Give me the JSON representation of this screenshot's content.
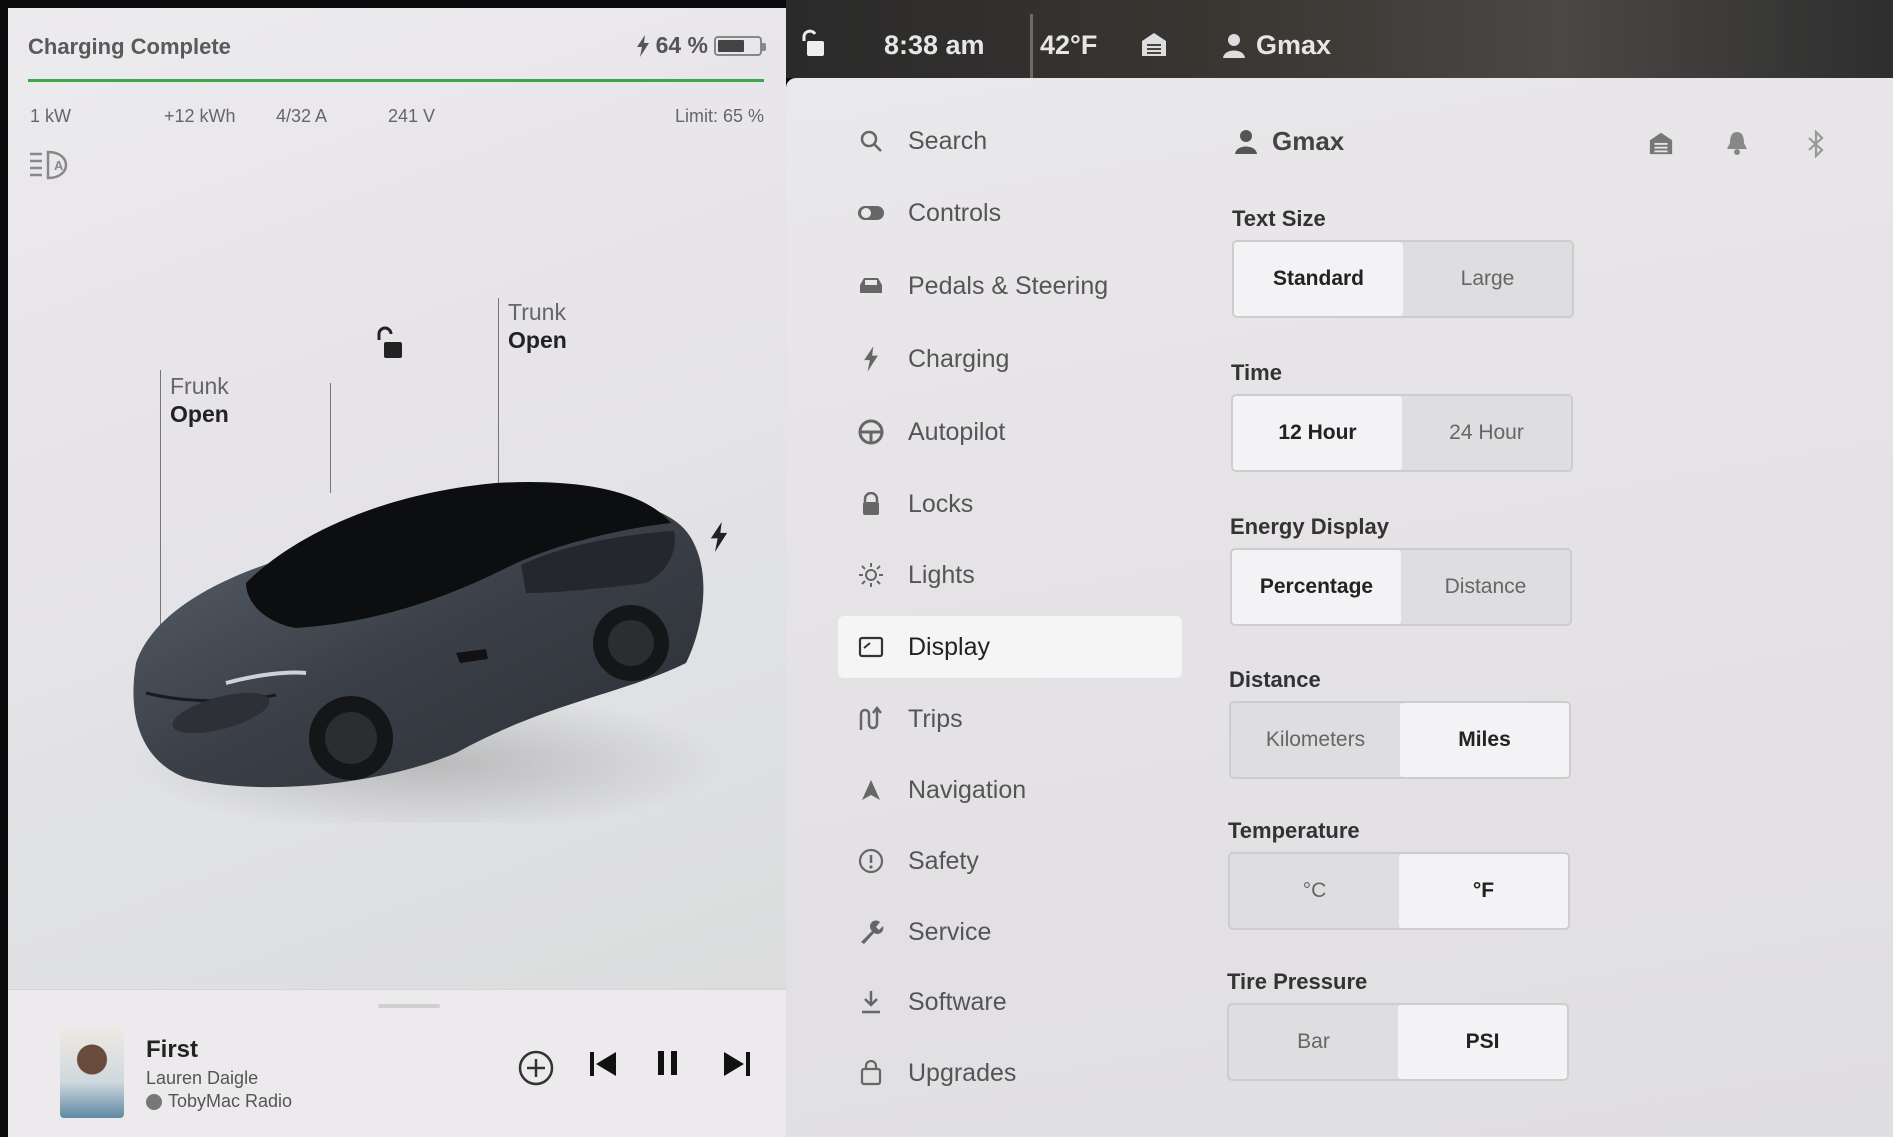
{
  "status_bar": {
    "time": "8:38 am",
    "temperature": "42°F",
    "user": "Gmax"
  },
  "charging": {
    "status": "Charging Complete",
    "battery_percent": "64 %",
    "battery_level": 0.64,
    "power": "1 kW",
    "energy_added": "+12 kWh",
    "current": "4/32 A",
    "voltage": "241 V",
    "limit": "Limit: 65 %"
  },
  "vehicle": {
    "frunk_label": "Frunk",
    "frunk_state": "Open",
    "trunk_label": "Trunk",
    "trunk_state": "Open"
  },
  "media": {
    "song": "First",
    "artist": "Lauren Daigle",
    "station": "TobyMac Radio"
  },
  "menu": {
    "items": [
      {
        "label": "Search",
        "icon": "search-icon"
      },
      {
        "label": "Controls",
        "icon": "toggle-icon"
      },
      {
        "label": "Pedals & Steering",
        "icon": "car-icon"
      },
      {
        "label": "Charging",
        "icon": "bolt-icon"
      },
      {
        "label": "Autopilot",
        "icon": "steering-wheel-icon"
      },
      {
        "label": "Locks",
        "icon": "lock-icon"
      },
      {
        "label": "Lights",
        "icon": "sun-icon"
      },
      {
        "label": "Display",
        "icon": "display-icon"
      },
      {
        "label": "Trips",
        "icon": "trips-icon"
      },
      {
        "label": "Navigation",
        "icon": "navigation-icon"
      },
      {
        "label": "Safety",
        "icon": "alert-icon"
      },
      {
        "label": "Service",
        "icon": "wrench-icon"
      },
      {
        "label": "Software",
        "icon": "download-icon"
      },
      {
        "label": "Upgrades",
        "icon": "bag-icon"
      }
    ],
    "active": "Display"
  },
  "display": {
    "profile": "Gmax",
    "text_size": {
      "label": "Text Size",
      "options": [
        "Standard",
        "Large"
      ],
      "selected": "Standard"
    },
    "time": {
      "label": "Time",
      "options": [
        "12 Hour",
        "24 Hour"
      ],
      "selected": "12 Hour"
    },
    "energy_display": {
      "label": "Energy Display",
      "options": [
        "Percentage",
        "Distance"
      ],
      "selected": "Percentage"
    },
    "distance": {
      "label": "Distance",
      "options": [
        "Kilometers",
        "Miles"
      ],
      "selected": "Miles"
    },
    "temperature": {
      "label": "Temperature",
      "options": [
        "°C",
        "°F"
      ],
      "selected": "°F"
    },
    "tire_pressure": {
      "label": "Tire Pressure",
      "options": [
        "Bar",
        "PSI"
      ],
      "selected": "PSI"
    }
  },
  "colors": {
    "charge_bar": "#3ea64a",
    "panel_bg": "#e8e7ea",
    "selected_segment": "#f3f2f4"
  }
}
